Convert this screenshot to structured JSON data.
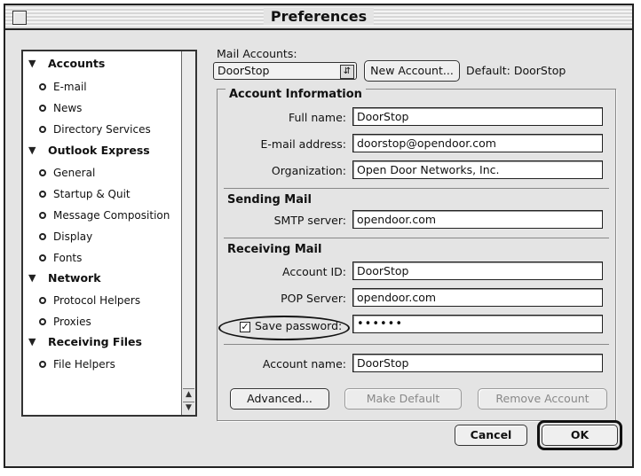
{
  "window": {
    "title": "Preferences"
  },
  "sidebar": {
    "categories": [
      {
        "label": "Accounts",
        "items": [
          "E-mail",
          "News",
          "Directory Services"
        ]
      },
      {
        "label": "Outlook Express",
        "items": [
          "General",
          "Startup & Quit",
          "Message Composition",
          "Display",
          "Fonts"
        ]
      },
      {
        "label": "Network",
        "items": [
          "Protocol Helpers",
          "Proxies"
        ]
      },
      {
        "label": "Receiving Files",
        "items": [
          "File Helpers"
        ]
      }
    ]
  },
  "mail_accounts": {
    "label": "Mail Accounts:",
    "selected": "DoorStop",
    "new_account_button": "New Account...",
    "default_label": "Default: DoorStop"
  },
  "account_information": {
    "title": "Account Information",
    "full_name_label": "Full name:",
    "full_name_value": "DoorStop",
    "email_label": "E-mail address:",
    "email_value": "doorstop@opendoor.com",
    "organization_label": "Organization:",
    "organization_value": "Open Door Networks, Inc."
  },
  "sending_mail": {
    "title": "Sending Mail",
    "smtp_label": "SMTP server:",
    "smtp_value": "opendoor.com"
  },
  "receiving_mail": {
    "title": "Receiving Mail",
    "account_id_label": "Account ID:",
    "account_id_value": "DoorStop",
    "pop_label": "POP Server:",
    "pop_value": "opendoor.com",
    "save_password_label": "Save password:",
    "save_password_checked": true,
    "password_value": "••••••"
  },
  "account_name": {
    "label": "Account name:",
    "value": "DoorStop"
  },
  "buttons": {
    "advanced": "Advanced...",
    "make_default": "Make Default",
    "remove_account": "Remove Account",
    "cancel": "Cancel",
    "ok": "OK"
  }
}
